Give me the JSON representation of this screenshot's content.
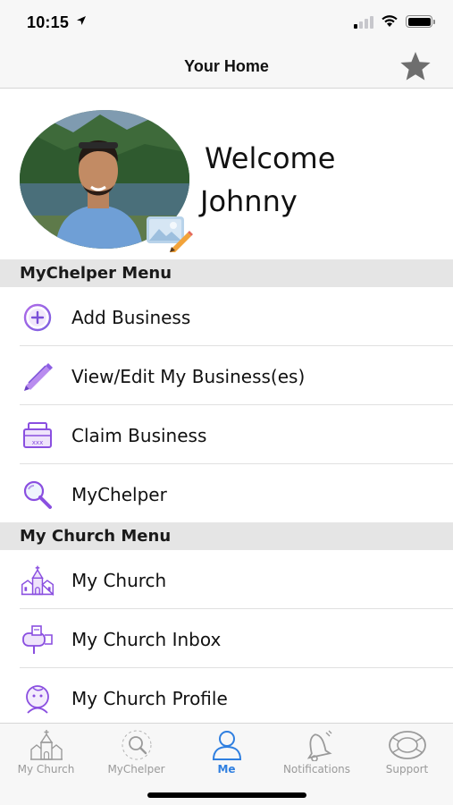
{
  "status_bar": {
    "time": "10:15"
  },
  "nav": {
    "title": "Your Home",
    "favorite_icon": "star-icon"
  },
  "profile": {
    "welcome": "Welcome",
    "name": "Johnny"
  },
  "sections": [
    {
      "title": "MyChelper Menu",
      "items": [
        {
          "label": "Add Business",
          "icon": "add-circle-icon"
        },
        {
          "label": "View/Edit My Business(es)",
          "icon": "pencil-icon"
        },
        {
          "label": "Claim Business",
          "icon": "register-icon"
        },
        {
          "label": "MyChelper",
          "icon": "magnifier-icon"
        }
      ]
    },
    {
      "title": "My Church Menu",
      "items": [
        {
          "label": "My Church",
          "icon": "church-icon"
        },
        {
          "label": "My Church Inbox",
          "icon": "mailbox-icon"
        },
        {
          "label": "My Church Profile",
          "icon": "profile-face-icon"
        }
      ]
    }
  ],
  "tabs": [
    {
      "label": "My Church",
      "icon": "church-icon",
      "active": false
    },
    {
      "label": "MyChelper",
      "icon": "magnifier-icon",
      "active": false
    },
    {
      "label": "Me",
      "icon": "person-icon",
      "active": true
    },
    {
      "label": "Notifications",
      "icon": "bell-icon",
      "active": false
    },
    {
      "label": "Support",
      "icon": "lifebuoy-icon",
      "active": false
    }
  ],
  "colors": {
    "accent_purple": "#8a4fe0",
    "accent_blue": "#2f7fe0",
    "tab_inactive": "#9a9a9a",
    "section_bg": "#e5e5e5"
  }
}
